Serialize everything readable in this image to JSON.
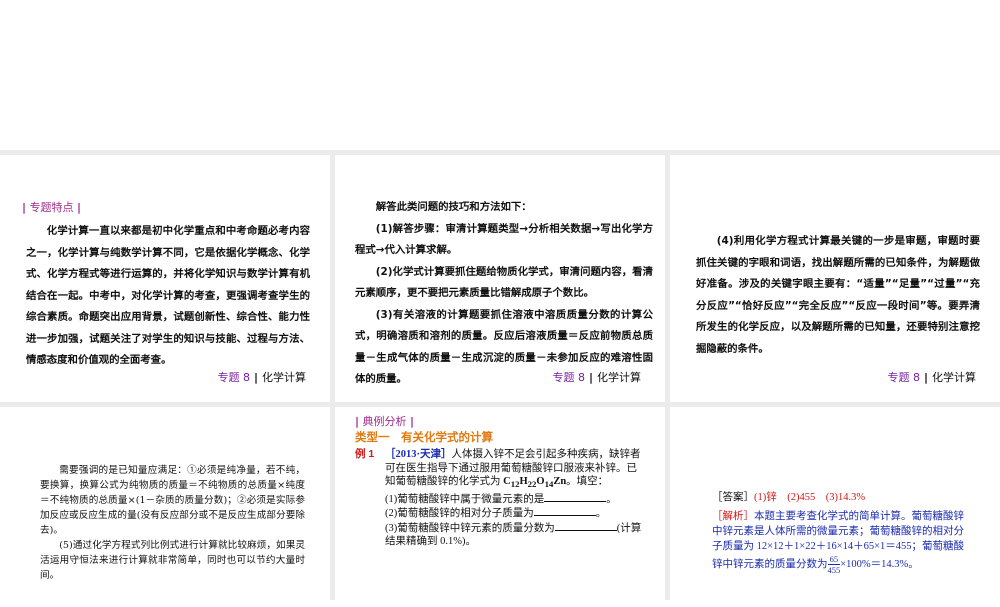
{
  "slide1": {
    "section": "专题特点",
    "text": "化学计算一直以来都是初中化学重点和中考命题必考内容之一，化学计算与纯数学计算不同，它是依据化学概念、化学式、化学方程式等进行运算的，并将化学知识与数学计算有机结合在一起。中考中，对化学计算的考查，更强调考查学生的综合素质。命题突出应用背景，试题创新性、综合性、能力性进一步加强，试题关注了对学生的知识与技能、过程与方法、情感态度和价值观的全面考查。"
  },
  "slide2": {
    "intro": "解答此类问题的技巧和方法如下：",
    "p1": "(1)解答步骤：审清计算题类型→分析相关数据→写出化学方程式→代入计算求解。",
    "p2": "(2)化学式计算要抓住题给物质化学式，审清问题内容，看清元素顺序，更不要把元素质量比错解成原子个数比。",
    "p3": "(3)有关溶液的计算题要抓住溶液中溶质质量分数的计算公式，明确溶质和溶剂的质量。反应后溶液质量＝反应前物质总质量－生成气体的质量－生成沉淀的质量－未参加反应的难溶性固体的质量。"
  },
  "slide3": {
    "p4": "(4)利用化学方程式计算最关键的一步是审题，审题时要抓住关键的字眼和词语，找出解题所需的已知条件，为解题做好准备。涉及的关键字眼主要有：“适量”“足量”“过量”“充分反应”“恰好反应”“完全反应”“反应一段时间”等。要弄清所发生的化学反应，以及解题所需的已知量，还要特别注意挖掘隐蔽的条件。"
  },
  "slide4": {
    "p1": "需要强调的是已知量应满足：①必须是纯净量，若不纯，要换算，换算公式为纯物质的质量＝不纯物质的总质量×纯度＝不纯物质的总质量×(1－杂质的质量分数)；②必须是实际参加反应或反应生成的量(没有反应部分或不是反应生成部分要除去)。",
    "p2": "(5)通过化学方程式列比例式进行计算就比较麻烦，如果灵活运用守恒法来进行计算就非常简单，同时也可以节约大量时间。"
  },
  "slide5": {
    "section": "典例分析",
    "type": "类型一　有关化学式的计算",
    "ex_label": "例 1",
    "source": "［2013·天津］",
    "stem1": "人体摄入锌不足会引起多种疾病，缺锌者可在医生指导下通过服用葡萄糖酸锌口服液来补锌。已知葡萄糖酸锌的化学式为 ",
    "formula": "C12H22O14Zn",
    "stem2": "。填空：",
    "q1": "(1)葡萄糖酸锌中属于微量元素的是",
    "q2": "(2)葡萄糖酸锌的相对分子质量为",
    "q3": "(3)葡萄糖酸锌中锌元素的质量分数为",
    "q3b": "(计算结果精确到 0.1%)。",
    "end": "。"
  },
  "slide6": {
    "answer_label": "［答案］",
    "answer": "(1)锌　(2)455　(3)14.3%",
    "analysis_label": "［解析］",
    "analysis": "本题主要考查化学式的简单计算。葡萄糖酸锌中锌元素是人体所需的微量元素；葡萄糖酸锌的相对分子质量为 12×12＋1×22＋16×14＋65×1＝455；葡萄糖酸锌中锌元素的质量分数为",
    "num": "65",
    "den": "455",
    "tail": "×100%＝14.3%。"
  },
  "footer": {
    "topic": "专题 8",
    "title": "化学计算"
  },
  "colors": {
    "section": "#a0288c",
    "type": "#e07a10",
    "red": "#d01818",
    "blue": "#1a2bb0"
  }
}
